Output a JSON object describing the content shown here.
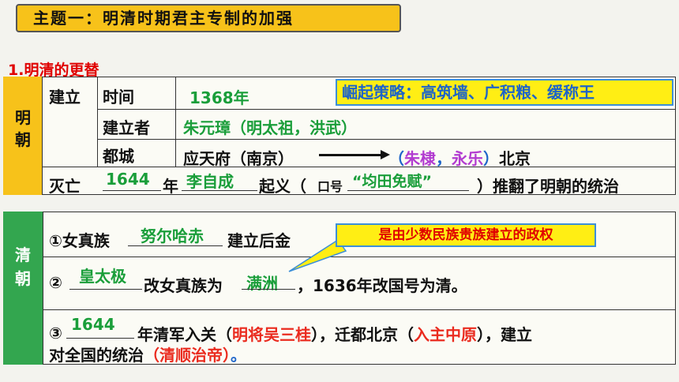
{
  "title": "主题一：明清时期君主专制的加强",
  "section_title": "1.明清的更替",
  "ming": {
    "label": "明朝",
    "row_establish": "建立",
    "row_fall": "灭亡",
    "time_label": "时间",
    "time_value": "1368年",
    "founder_label": "建立者",
    "founder_value": "朱元璋（明太祖，洪武）",
    "capital_label": "都城",
    "capital_from": "应天府（南京）",
    "capital_paren_open": "（",
    "capital_emperor": "朱棣",
    "capital_sep": "，",
    "capital_era": "永乐",
    "capital_paren_close": "）",
    "capital_to": "北京",
    "strategy": "崛起策略：高筑墙、广积粮、缓称王",
    "fall_year": "1644",
    "fall_year_suffix": "年",
    "fall_leader": "李自成",
    "fall_mid": "起义（",
    "fall_slogan_label": "口号",
    "fall_slogan": "“均田免赋”",
    "fall_end": "）推翻了明朝的统治"
  },
  "qing": {
    "label": "清朝",
    "row1_prefix": "①女真族",
    "row1_blank": "努尔哈赤",
    "row1_suffix": "建立后金",
    "callout": "是由少数民族贵族建立的政权",
    "row2_prefix": "②",
    "row2_blank": "皇太极",
    "row2_mid": "改女真族为",
    "row2_blank2": "满洲",
    "row2_suffix": "，1636年改国号为清。",
    "row3_prefix": "③",
    "row3_year": "1644",
    "row3_a": "年清军入关（",
    "row3_general": "明将吴三桂",
    "row3_b": "），迁都北京（",
    "row3_c": "入主中原",
    "row3_d": "），建立",
    "row3_e": "对全国的统治",
    "row3_f": "（清顺治帝）",
    "row3_g": "。"
  },
  "colors": {
    "title_bg": "#f7c21a",
    "ming_label_bg": "#f7c21a",
    "qing_label_bg": "#33a64f",
    "callout_bg": "#ffee14",
    "answer_green": "#1a9e3a",
    "answer_purple": "#b23bd0",
    "answer_red": "#ea2b1f"
  }
}
